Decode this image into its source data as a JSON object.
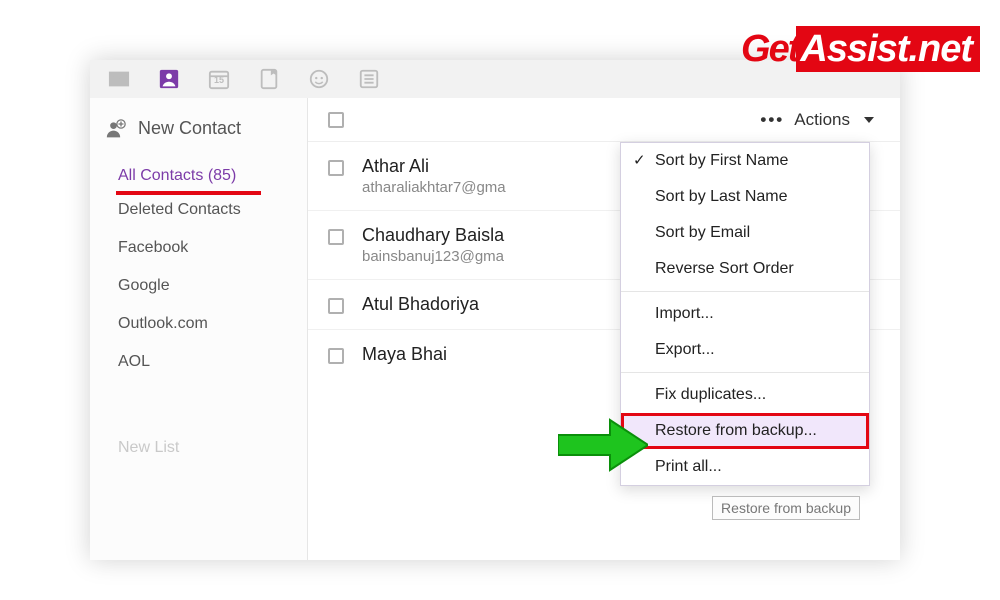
{
  "watermark": {
    "left": "Get",
    "right": "Assist.net"
  },
  "iconbar": {
    "icons": [
      "mail-icon",
      "contacts-icon",
      "calendar-icon",
      "notes-icon",
      "messenger-icon",
      "list-icon"
    ],
    "calendar_day": "15"
  },
  "sidebar": {
    "new_contact_label": "New Contact",
    "items": [
      {
        "label": "All Contacts (85)",
        "active": true
      },
      {
        "label": "Deleted Contacts"
      },
      {
        "label": "Facebook"
      },
      {
        "label": "Google"
      },
      {
        "label": "Outlook.com"
      },
      {
        "label": "AOL"
      }
    ],
    "new_list_label": "New List"
  },
  "header": {
    "actions_label": "Actions"
  },
  "contacts": [
    {
      "name": "Athar Ali",
      "email": "atharaliakhtar7@gma"
    },
    {
      "name": "Chaudhary Baisla",
      "email": "bainsbanuj123@gma"
    },
    {
      "name": "Atul Bhadoriya",
      "email": ""
    },
    {
      "name": "Maya Bhai",
      "email": ""
    }
  ],
  "menu": {
    "items": [
      {
        "label": "Sort by First Name",
        "checked": true
      },
      {
        "label": "Sort by Last Name"
      },
      {
        "label": "Sort by Email"
      },
      {
        "label": "Reverse Sort Order"
      },
      {
        "sep": true
      },
      {
        "label": "Import..."
      },
      {
        "label": "Export..."
      },
      {
        "sep": true
      },
      {
        "label": "Fix duplicates..."
      },
      {
        "label": "Restore from backup...",
        "highlight": true
      },
      {
        "label": "Print all..."
      }
    ]
  },
  "tooltip": "Restore from backup"
}
